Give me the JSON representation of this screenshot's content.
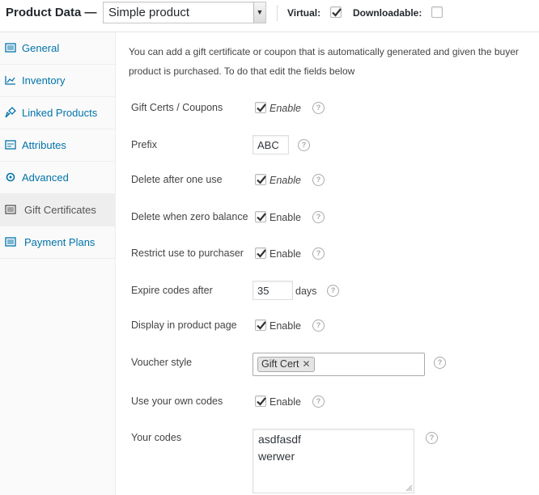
{
  "header": {
    "title": "Product Data —",
    "product_type": "Simple product",
    "virtual_label": "Virtual:",
    "virtual_checked": true,
    "downloadable_label": "Downloadable:",
    "downloadable_checked": false
  },
  "sidebar": {
    "items": [
      {
        "label": "General",
        "icon": "general-icon",
        "active": false
      },
      {
        "label": "Inventory",
        "icon": "inventory-icon",
        "active": false
      },
      {
        "label": "Linked Products",
        "icon": "link-icon",
        "active": false
      },
      {
        "label": "Attributes",
        "icon": "attributes-icon",
        "active": false
      },
      {
        "label": "Advanced",
        "icon": "gear-icon",
        "active": false
      },
      {
        "label": "Gift Certificates",
        "icon": "gift-certificate-icon",
        "active": true
      },
      {
        "label": "Payment Plans",
        "icon": "payment-plans-icon",
        "active": false
      }
    ]
  },
  "main": {
    "intro_line1": "You can add a gift certificate or coupon that is automatically generated and given the buyer",
    "intro_line2": "product is purchased. To do that edit the fields below",
    "enable_label": "Enable",
    "gift_certs_label": "Gift Certs / Coupons",
    "gift_certs_checked": true,
    "prefix_label": "Prefix",
    "prefix_value": "ABC",
    "delete_after_label": "Delete after one use",
    "delete_after_checked": true,
    "delete_zero_label": "Delete when zero balance",
    "delete_zero_checked": true,
    "restrict_label": "Restrict use to purchaser",
    "restrict_checked": true,
    "expire_label": "Expire codes after",
    "expire_value": "35",
    "expire_unit": "days",
    "display_label": "Display in product page",
    "display_checked": true,
    "voucher_label": "Voucher style",
    "voucher_tag": "Gift Cert",
    "own_codes_label": "Use your own codes",
    "own_codes_checked": true,
    "your_codes_label": "Your codes",
    "codes": [
      "asdfasdf",
      "werwer"
    ],
    "help_glyph": "?"
  },
  "colors": {
    "link_blue": "#0073aa",
    "active_tab_bg": "#eeeeee",
    "sidebar_bg": "#fafafa"
  }
}
